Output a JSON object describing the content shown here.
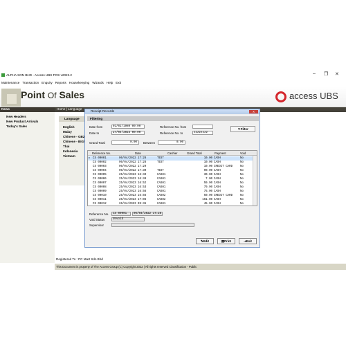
{
  "app": {
    "title": "ALPHA SON BHD - Access UBS POS v2022.2",
    "menu": [
      "Maintenance",
      "Transaction",
      "Enquiry",
      "Reports",
      "Housekeeping",
      "Wizards",
      "Help",
      "Exit"
    ],
    "product_name_a": "Point ",
    "product_name_b": "Of",
    "product_name_c": " Sales",
    "brand": "access UBS",
    "accent": "#d4262c"
  },
  "sidebar": {
    "heading": "News",
    "items": [
      "New Headers",
      "New Product Arrivals",
      "Today's Sales"
    ]
  },
  "homebar": "Home | Language",
  "language": {
    "heading": "Language",
    "items": [
      "English",
      "Malay",
      "Chinese - GB2",
      "Chinese - BIG5",
      "Thai",
      "Indonesia",
      "Vietnam"
    ]
  },
  "dialog": {
    "title": "Receipt Records",
    "filter_heading": "Filtering",
    "date_from_label": "Date from",
    "date_from": "01/01/1980 00:00",
    "date_to_label": "Date to",
    "date_to": "27/04/2023 00:00",
    "ref_from_label": "Reference No. from",
    "ref_from": "",
    "ref_to_label": "Reference No. to",
    "ref_to": "zzzzzzzz",
    "filter_button": "Filter",
    "grand_total_label": "Grand Total",
    "grand_total_from": "0.00",
    "between_label": "Between",
    "grand_total_to": "0.00",
    "columns": [
      "Reference No.",
      "Date",
      "Cashier",
      "Grand Total",
      "Payment",
      "Void"
    ],
    "rows": [
      [
        "CS 00001",
        "06/04/2022 17:28",
        "TEST",
        "10.00",
        "CASH",
        "No"
      ],
      [
        "CS 00002",
        "06/04/2022 17:28",
        "TEST",
        "10.00",
        "CASH",
        "No"
      ],
      [
        "CS 00003",
        "06/04/2022 17:29",
        "",
        "10.00",
        "CREDIT CARD",
        "No"
      ],
      [
        "CS 00004",
        "06/04/2022 17:30",
        "TEST",
        "90.00",
        "CASH",
        "No"
      ],
      [
        "CS 00005",
        "25/04/2023 16:49",
        "CASH1",
        "30.00",
        "CASH",
        "No"
      ],
      [
        "CS 00006",
        "25/04/2023 16:49",
        "CASH1",
        "7.00",
        "CASH",
        "No"
      ],
      [
        "CS 00007",
        "25/04/2023 16:52",
        "CASH1",
        "59.90",
        "CASH",
        "No"
      ],
      [
        "CS 00008",
        "25/04/2023 16:53",
        "CASH1",
        "79.90",
        "CASH",
        "No"
      ],
      [
        "CS 00009",
        "25/04/2023 16:56",
        "CASH1",
        "75.00",
        "CASH",
        "No"
      ],
      [
        "CS 00010",
        "25/04/2023 16:56",
        "CASH2",
        "50.00",
        "CREDIT CARD",
        "No"
      ],
      [
        "CS 00011",
        "25/04/2023 17:06",
        "CASH2",
        "161.00",
        "CASH",
        "No"
      ],
      [
        "CS 00012",
        "26/04/2023 09:45",
        "CASH1",
        "45.00",
        "CASH",
        "No"
      ]
    ],
    "reference_label": "Reference No.",
    "reference_value": "CS 00001",
    "reference_date": "06/04/2022 17:28",
    "void_status_label": "Void Status",
    "void_status": "Unvoid",
    "supervisor_label": "Supervisor",
    "supervisor": "",
    "edit_button": "Edit",
    "print_button": "Print",
    "exit_button": "Exit"
  },
  "registered": "Registered To : PC Mart Sdn Bhd",
  "footer": "This Document is property of The Access Group (C) Copyright 2022 | All rights reserved   Classification - Public"
}
